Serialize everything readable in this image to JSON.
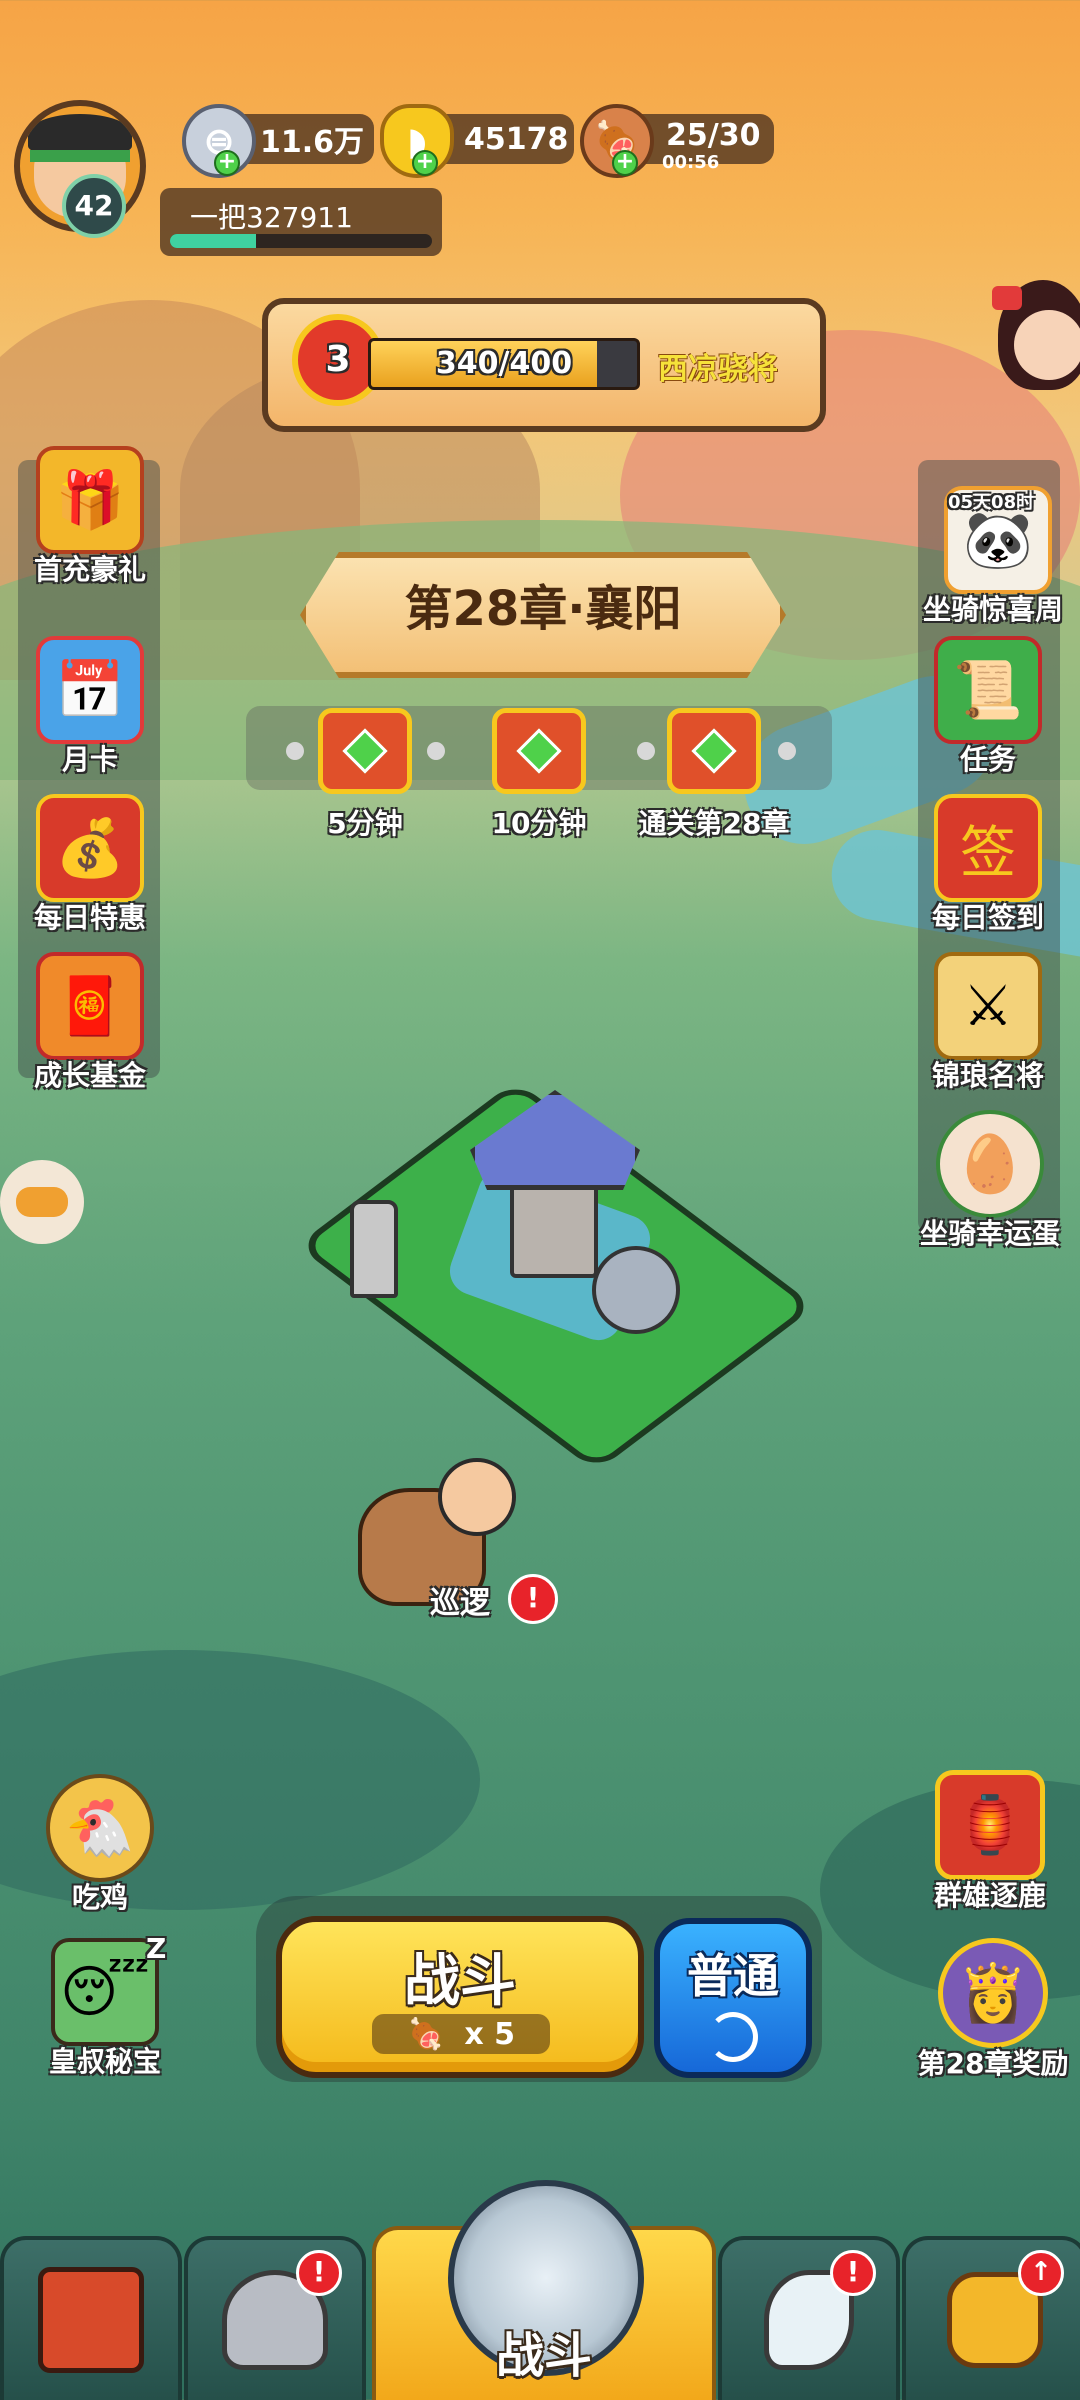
{
  "player": {
    "level": "42",
    "name": "一把327911",
    "exp_fraction": 0.33
  },
  "resources": {
    "silver": "11.6万",
    "gold": "45178",
    "stamina": "25/30",
    "stamina_timer": "00:56"
  },
  "rank": {
    "badge_number": "3",
    "progress_text": "340/400",
    "progress_fraction": 0.85,
    "title": "西凉骁将"
  },
  "chapter": {
    "title": "第28章·襄阳"
  },
  "rewards": [
    {
      "label": "5分钟"
    },
    {
      "label": "10分钟"
    },
    {
      "label": "通关第28章"
    }
  ],
  "left_menu": [
    {
      "label": "首充豪礼",
      "icon": "treasure-chest-icon"
    },
    {
      "label": "月卡",
      "icon": "month-card-icon"
    },
    {
      "label": "每日特惠",
      "icon": "gift-bag-icon"
    },
    {
      "label": "成长基金",
      "icon": "fortune-god-icon"
    }
  ],
  "right_menu": [
    {
      "label": "坐骑惊喜周",
      "timer": "05天08时",
      "icon": "mount-panda-icon"
    },
    {
      "label": "任务",
      "icon": "quest-scroll-icon"
    },
    {
      "label": "每日签到",
      "icon": "sign-in-icon"
    },
    {
      "label": "锦琅名将",
      "icon": "general-helmet-icon"
    },
    {
      "label": "坐骑幸运蛋",
      "icon": "lucky-egg-icon"
    }
  ],
  "patrol": {
    "label": "巡逻",
    "alert": "!"
  },
  "left_bottom": [
    {
      "label": "吃鸡",
      "icon": "chicken-icon"
    },
    {
      "label": "皇叔秘宝",
      "icon": "sleeping-uncle-icon",
      "sleep": "Z"
    }
  ],
  "right_bottom": [
    {
      "label": "群雄逐鹿",
      "icon": "banner-scroll-icon"
    },
    {
      "label": "第28章奖励",
      "icon": "chapter-reward-icon"
    }
  ],
  "battle": {
    "label": "战斗",
    "cost": "x 5",
    "mode_label": "普通"
  },
  "nav": {
    "center_label": "战斗",
    "alert": "!"
  },
  "colors": {
    "accent_yellow": "#f7c81e",
    "mode_blue": "#1b7de0",
    "alert_red": "#e8232a"
  }
}
